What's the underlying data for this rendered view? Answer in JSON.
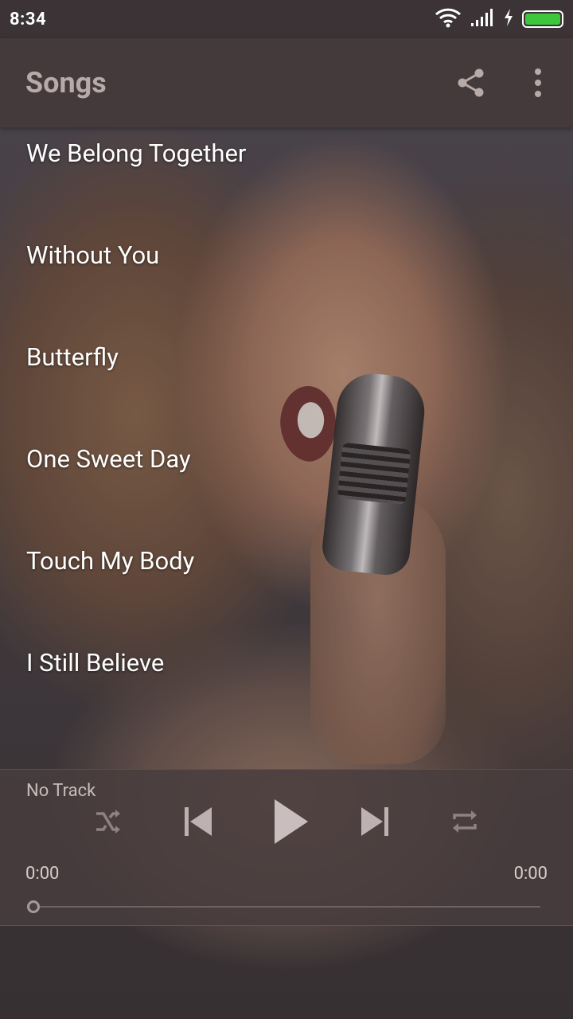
{
  "status_bar": {
    "time": "8:34",
    "icons": [
      "wifi-icon",
      "signal-icon",
      "charging-icon",
      "battery-icon"
    ],
    "battery_color": "#3ec63c"
  },
  "app_bar": {
    "title": "Songs",
    "actions": [
      "share-icon",
      "more-vert-icon"
    ],
    "background": "#453a3b"
  },
  "songs": [
    {
      "title": "We Belong Together"
    },
    {
      "title": "Without You"
    },
    {
      "title": "Butterfly"
    },
    {
      "title": "One Sweet Day"
    },
    {
      "title": "Touch My Body"
    },
    {
      "title": "I Still Believe"
    }
  ],
  "player": {
    "track": "No Track",
    "elapsed": "0:00",
    "duration": "0:00",
    "progress": 0,
    "controls": [
      "shuffle-icon",
      "previous-icon",
      "play-icon",
      "next-icon",
      "repeat-icon"
    ]
  }
}
